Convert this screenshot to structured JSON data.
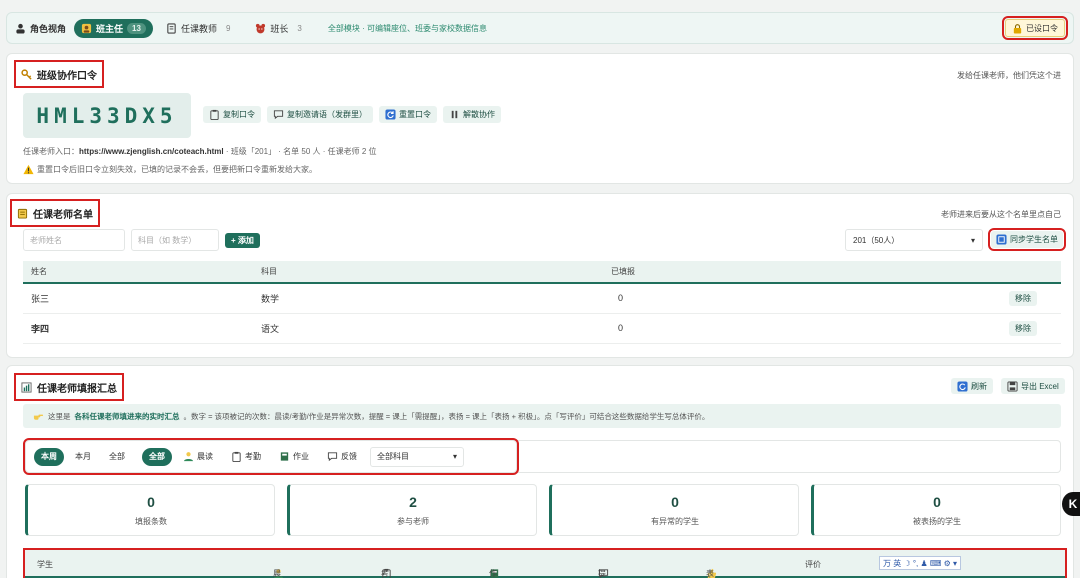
{
  "rolebar": {
    "title": "角色视角",
    "roles": [
      {
        "label": "班主任",
        "count": "13"
      },
      {
        "label": "任课教师",
        "count": "9"
      },
      {
        "label": "班长",
        "count": "3"
      }
    ],
    "note": "全部模块 · 可编辑座位、班委与家校数据信息",
    "set_code_label": "已设口令"
  },
  "code_card": {
    "title": "班级协作口令",
    "right_note": "发给任课老师，他们凭这个进",
    "code": "HML33DX5",
    "actions": {
      "copy_code": "复制口令",
      "copy_invite": "复制邀请语（发群里）",
      "reset_code": "重置口令",
      "dissolve": "解散协作"
    },
    "entry_label": "任课老师入口：",
    "entry_url": "https://www.zjenglish.cn/coteach.html",
    "entry_meta": " · 班级「201」 · 名单 50 人 · 任课老师 2 位",
    "warning": "重置口令后旧口令立刻失效，已填的记录不会丢，但要把新口令重新发给大家。"
  },
  "teachers_card": {
    "title": "任课老师名单",
    "right_note": "老师进来后要从这个名单里点自己",
    "name_placeholder": "老师姓名",
    "subject_placeholder": "科目（如 数学）",
    "add_label": "+ 添加",
    "class_select": "201（50人）",
    "sync_label": "同步学生名单",
    "columns": [
      "姓名",
      "科目",
      "已填报"
    ],
    "rows": [
      {
        "name": "张三",
        "subject": "数学",
        "filled": "0",
        "action": "移除"
      },
      {
        "name": "李四",
        "subject": "语文",
        "filled": "0",
        "action": "移除"
      }
    ]
  },
  "summary_card": {
    "title": "任课老师填报汇总",
    "refresh_label": "刷新",
    "export_label": "导出 Excel",
    "info_prefix": "这里是",
    "info_highlight": "各科任课老师填进来的实时汇总",
    "info_rest": "。数字 = 该项被记的次数：晨读/考勤/作业是异常次数，提醒 = 课上「需提醒」，表扬 = 课上「表扬 + 积极」。点「写评价」可结合这些数据给学生写总体评价。",
    "period_filters": [
      "本周",
      "本月",
      "全部"
    ],
    "type_filters": [
      {
        "label": "全部",
        "icon": ""
      },
      {
        "label": "晨读",
        "icon": "reading-icon"
      },
      {
        "label": "考勤",
        "icon": "clipboard-icon"
      },
      {
        "label": "作业",
        "icon": "notebook-icon"
      },
      {
        "label": "反馈",
        "icon": "speech-icon"
      }
    ],
    "subject_select": "全部科目",
    "stats": [
      {
        "value": "0",
        "label": "填报条数"
      },
      {
        "value": "2",
        "label": "参与老师"
      },
      {
        "value": "0",
        "label": "有异常的学生"
      },
      {
        "value": "0",
        "label": "被表扬的学生"
      }
    ],
    "table_columns": [
      "学生",
      "晨读",
      "考勤",
      "作业",
      "提醒",
      "表扬",
      "评价"
    ],
    "ime_text": "万 英 ☽ °, ♟ ⌨ ⚙ ▾"
  },
  "side_badge": "K",
  "colors": {
    "accent": "#1f6f5c",
    "highlight": "#d62020",
    "tint": "#eaf3f0"
  }
}
